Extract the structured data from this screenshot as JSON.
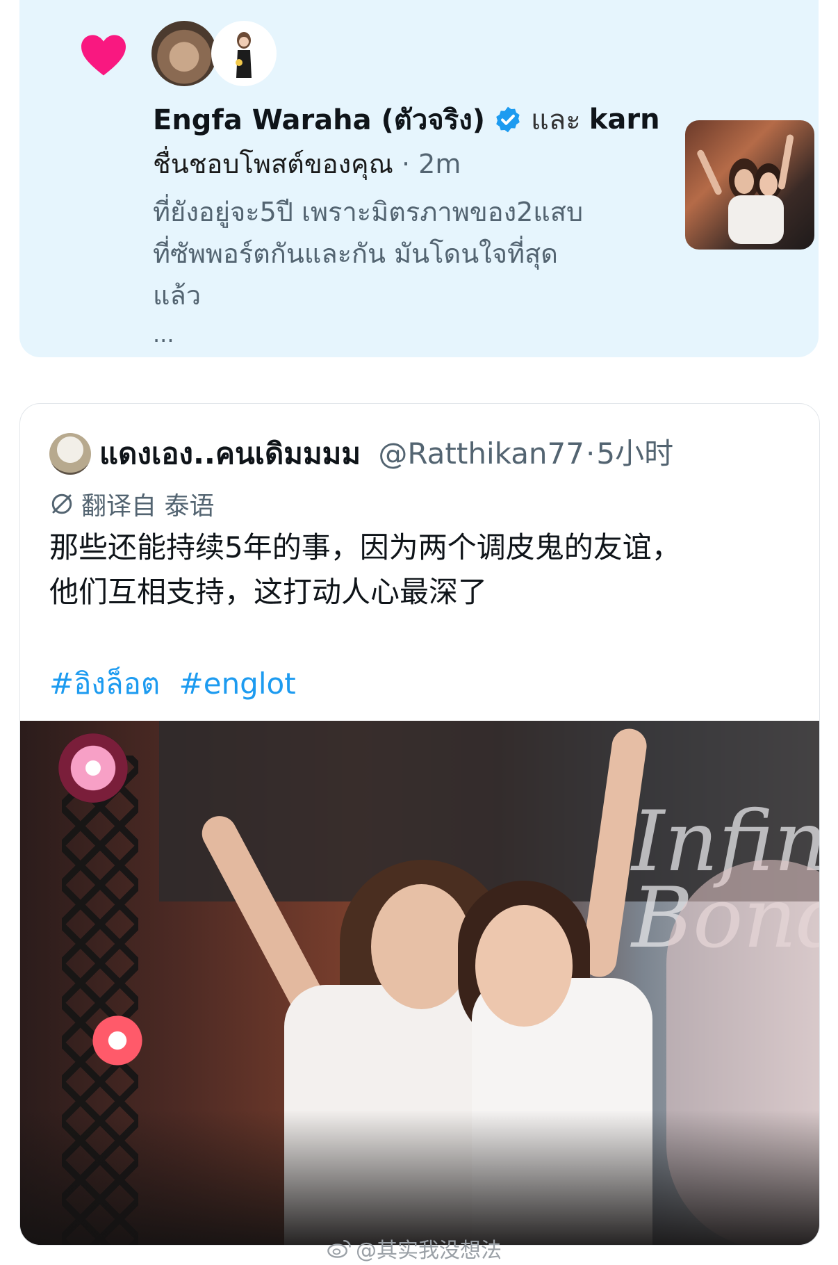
{
  "notification": {
    "actor1": "Engfa Waraha (ตัวจริง)",
    "conjunction": "และ",
    "actor2": "karn",
    "action": "ชื่นชอบโพสต์ของคุณ",
    "separator": "·",
    "time": "2m",
    "preview_line1": "ที่ยังอยู่จะ5ปี เพราะมิตรภาพของ2แสบ",
    "preview_line2": "ที่ซัพพอร์ตกันและกัน มันโดนใจที่สุด",
    "preview_line3": "แล้ว",
    "ellipsis": "...",
    "icons": {
      "like": "heart-icon",
      "verified": "verified-badge-icon"
    },
    "colors": {
      "heart": "#f91880",
      "verified": "#1d9bf0",
      "background": "#e6f5fd"
    }
  },
  "tweet": {
    "display_name": "แดงเอง..คนเดิมมมม",
    "handle": "@Ratthikan77",
    "separator": "·",
    "time": "5小时",
    "translation_label": "翻译自 泰语",
    "body_line1": "那些还能持续5年的事，因为两个调皮鬼的友谊，",
    "body_line2": "他们互相支持，这打动人心最深了",
    "hashtags": [
      "#อิงล็อต",
      "#englot"
    ],
    "photo_sign_text": "Infini Bond",
    "icons": {
      "translate": "translate-icon"
    },
    "colors": {
      "hashtag": "#1d9bf0",
      "muted": "#536471"
    }
  },
  "watermark": {
    "text": "@其实我没想法",
    "icon": "weibo-logo-icon"
  }
}
